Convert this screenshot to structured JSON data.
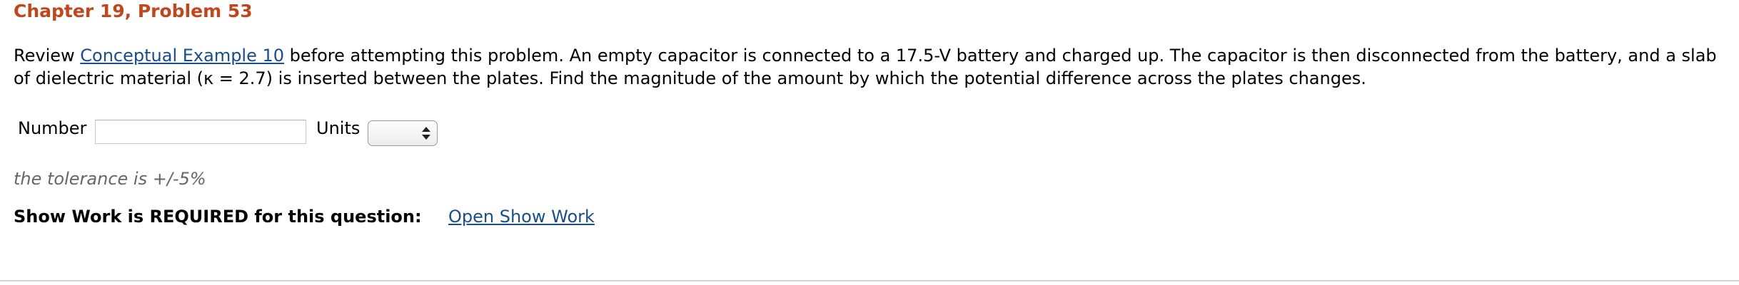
{
  "title": "Chapter 19, Problem 53",
  "problem": {
    "intro": "Review ",
    "link_text": "Conceptual Example 10",
    "body": " before attempting this problem. An empty capacitor is connected to a 17.5-V battery and charged up. The capacitor is then disconnected from the battery, and a slab of dielectric material (κ = 2.7) is inserted between the plates. Find the magnitude of the amount by which the potential difference across the plates changes."
  },
  "answer": {
    "number_label": "Number",
    "number_value": "",
    "units_label": "Units",
    "units_selected": ""
  },
  "tolerance_text": "the tolerance is +/-5%",
  "show_work": {
    "label": "Show Work is REQUIRED for this question:",
    "link_text": "Open Show Work"
  },
  "colors": {
    "title": "#c0461e",
    "link": "#1a4d8c",
    "muted": "#666666"
  }
}
